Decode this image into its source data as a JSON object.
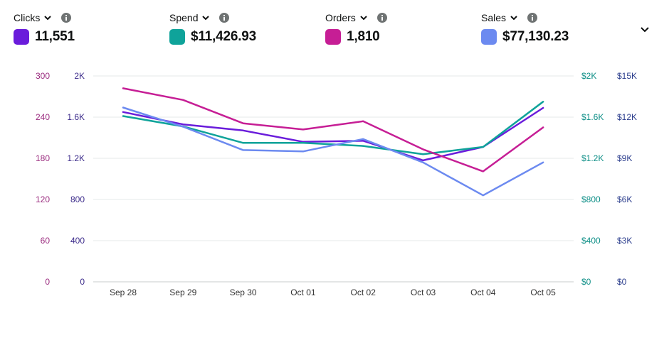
{
  "metrics": [
    {
      "name": "Clicks",
      "value": "11,551",
      "color": "#6a1cdb"
    },
    {
      "name": "Spend",
      "value": "$11,426.93",
      "color": "#0fa39a"
    },
    {
      "name": "Orders",
      "value": "1,810",
      "color": "#c61e95"
    },
    {
      "name": "Sales",
      "value": "$77,130.23",
      "color": "#6c8af0"
    }
  ],
  "icons": {
    "dropdown": "chevron-down-icon",
    "info": "info-icon",
    "collapse": "chevron-down-icon"
  },
  "chart_data": {
    "type": "line",
    "categories": [
      "Sep 28",
      "Sep 29",
      "Sep 30",
      "Oct 01",
      "Oct 02",
      "Oct 03",
      "Oct 04",
      "Oct 05"
    ],
    "axes": [
      {
        "id": "orders",
        "side": "left",
        "color": "#9b2c7f",
        "range": [
          0,
          300
        ],
        "ticks": [
          "0",
          "60",
          "120",
          "180",
          "240",
          "300"
        ]
      },
      {
        "id": "clicks",
        "side": "left",
        "color": "#3b2a8a",
        "range": [
          0,
          2000
        ],
        "ticks": [
          "0",
          "400",
          "800",
          "1.2K",
          "1.6K",
          "2K"
        ]
      },
      {
        "id": "spend",
        "side": "right",
        "color": "#0e8f87",
        "range": [
          0,
          2000
        ],
        "ticks": [
          "$0",
          "$400",
          "$800",
          "$1.2K",
          "$1.6K",
          "$2K"
        ]
      },
      {
        "id": "sales",
        "side": "right",
        "color": "#2a3c8c",
        "range": [
          0,
          15000
        ],
        "ticks": [
          "$0",
          "$3K",
          "$6K",
          "$9K",
          "$12K",
          "$15K"
        ]
      }
    ],
    "series": [
      {
        "name": "Clicks",
        "axis": "clicks",
        "color": "#6a1cdb",
        "values": [
          1650,
          1530,
          1470,
          1360,
          1370,
          1180,
          1310,
          1690
        ]
      },
      {
        "name": "Spend",
        "axis": "spend",
        "color": "#0fa39a",
        "values": [
          1610,
          1510,
          1350,
          1350,
          1320,
          1240,
          1310,
          1750
        ]
      },
      {
        "name": "Orders",
        "axis": "orders",
        "color": "#c61e95",
        "values": [
          282,
          265,
          231,
          222,
          234,
          193,
          161,
          225
        ]
      },
      {
        "name": "Sales",
        "axis": "sales",
        "color": "#6c8af0",
        "values": [
          12700,
          11300,
          9600,
          9500,
          10400,
          8700,
          6300,
          8700
        ]
      }
    ],
    "grid": true
  }
}
